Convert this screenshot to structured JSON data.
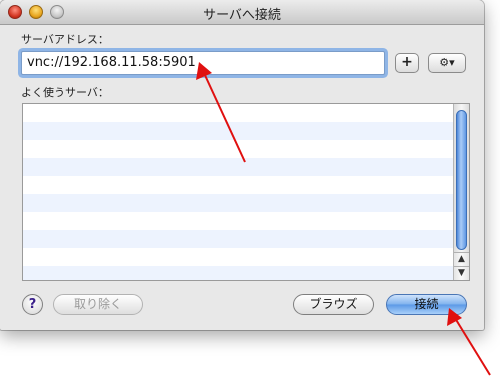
{
  "window": {
    "title": "サーバへ接続"
  },
  "address": {
    "label": "サーバアドレス：",
    "value": "vnc://192.168.11.58:5901",
    "add_label": "+",
    "action_icon": "gear-icon",
    "action_glyph": "⚙▾"
  },
  "favorites": {
    "label": "よく使うサーバ：",
    "row_count": 10
  },
  "scrollbar": {
    "up_glyph": "▲",
    "down_glyph": "▼"
  },
  "footer": {
    "help_label": "?",
    "remove_label": "取り除く",
    "browse_label": "ブラウズ",
    "connect_label": "接続"
  },
  "colors": {
    "annotation_red": "#e01010",
    "field_focus": "#8fb5e6",
    "default_button": "#5a98e6"
  }
}
